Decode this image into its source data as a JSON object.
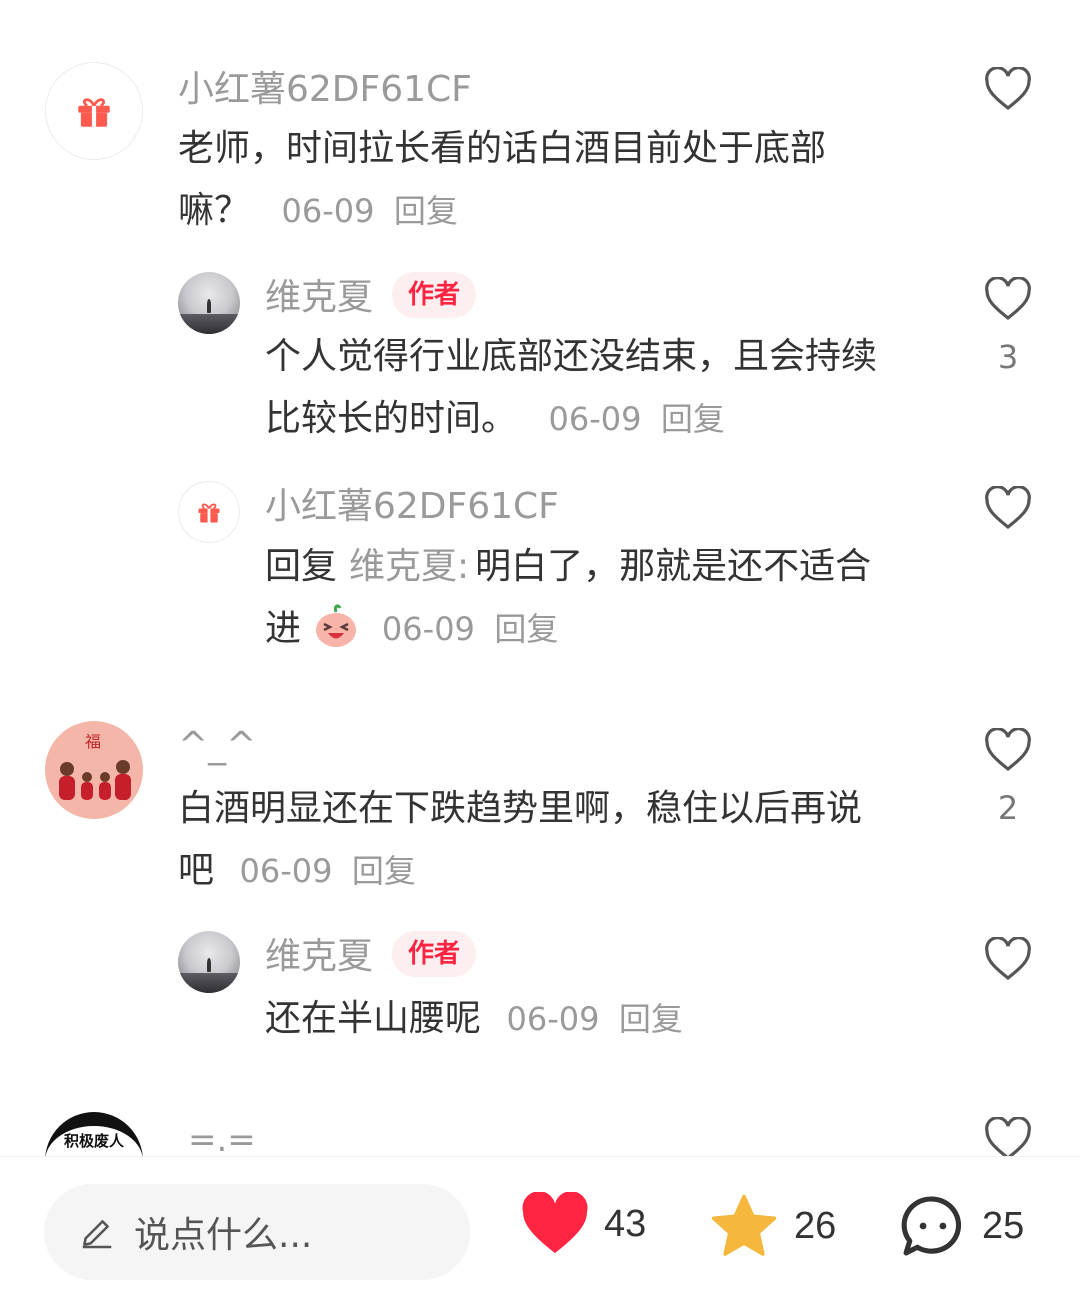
{
  "comments": [
    {
      "user": "小红薯62DF61CF",
      "text_line1": "老师，时间拉长看的话白酒目前处于底部",
      "text_line2": "嘛？",
      "date": "06-09",
      "reply": "回复",
      "replies": [
        {
          "user": "维克夏",
          "badge": "作者",
          "text_line1": "个人觉得行业底部还没结束，且会持续",
          "text_line2": "比较长的时间。",
          "date": "06-09",
          "reply": "回复",
          "likes": "3"
        },
        {
          "user": "小红薯62DF61CF",
          "reply_prefix": "回复",
          "reply_to": "维克夏:",
          "text_line1": "明白了，那就是还不适合",
          "text_line2": "进",
          "date": "06-09",
          "reply": "回复"
        }
      ]
    },
    {
      "user": "^_^",
      "text_line1": "白酒明显还在下跌趋势里啊，稳住以后再说",
      "text_line2": "吧",
      "date": "06-09",
      "reply": "回复",
      "likes": "2",
      "replies": [
        {
          "user": "维克夏",
          "badge": "作者",
          "text_line1": "还在半山腰呢",
          "date": "06-09",
          "reply": "回复"
        }
      ]
    },
    {
      "user": "=.=",
      "avatar_text": "积极废人"
    }
  ],
  "bottom_bar": {
    "input_placeholder": "说点什么...",
    "likes": "43",
    "collects": "26",
    "comments": "25"
  },
  "colors": {
    "accent": "#ff2442",
    "star": "#f5b83d",
    "muted": "#9a9a9a"
  }
}
